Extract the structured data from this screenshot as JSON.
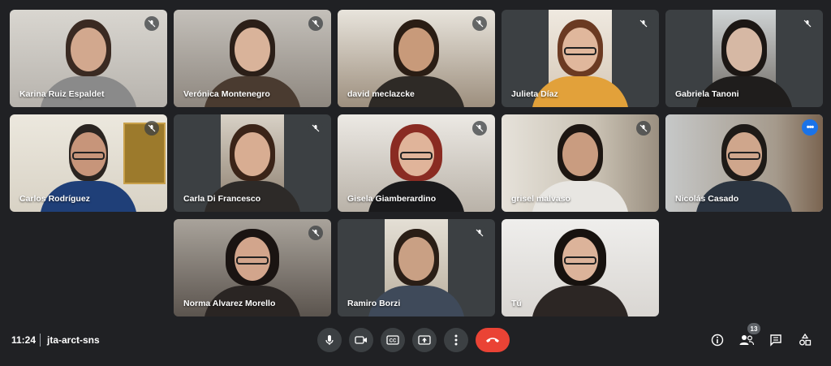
{
  "participants": [
    {
      "name": "Karina Ruiz Espaldet",
      "muted": true
    },
    {
      "name": "Verónica Montenegro",
      "muted": true
    },
    {
      "name": "david meclazcke",
      "muted": true
    },
    {
      "name": "Julieta Díaz",
      "muted": true
    },
    {
      "name": "Gabriela Tanoni",
      "muted": true
    },
    {
      "name": "Carlos Rodríguez",
      "muted": true
    },
    {
      "name": "Carla Di Francesco",
      "muted": true
    },
    {
      "name": "Gisela Giamberardino",
      "muted": true
    },
    {
      "name": "grisel malvaso",
      "muted": true
    },
    {
      "name": "Nicolás Casado",
      "muted": false,
      "active": true
    },
    {
      "name": "Norma Alvarez Morello",
      "muted": true
    },
    {
      "name": "Ramiro Borzi",
      "muted": true
    },
    {
      "name": "Tú",
      "muted": false
    }
  ],
  "bottom_bar": {
    "time": "11:24",
    "meeting_code": "jta-arct-sns",
    "controls": [
      "microphone-icon",
      "camera-icon",
      "captions-icon",
      "present-icon",
      "more-options-icon",
      "end-call-icon"
    ],
    "right_icons": [
      "info-icon",
      "people-icon",
      "chat-icon",
      "activities-icon"
    ],
    "people_count": "13"
  },
  "colors": {
    "background": "#202124",
    "tile": "#3c4043",
    "end_call": "#ea4335",
    "active_outline": "#8ab4f8"
  }
}
